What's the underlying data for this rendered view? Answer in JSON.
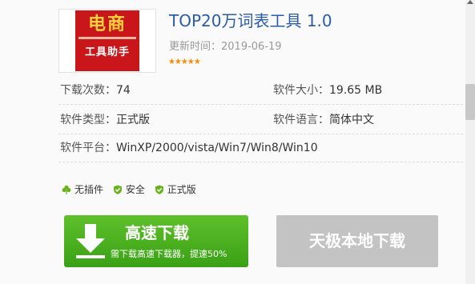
{
  "app": {
    "title": "TOP20万词表工具 1.0",
    "update_label": "更新时间：",
    "update_date": "2019-06-19",
    "rating_stars": "★★★★★"
  },
  "logo": {
    "line1": "电商",
    "line2": "工具助手",
    "brand_color": "#c9161b",
    "accent_color": "#ffd23c"
  },
  "info": {
    "downloads_label": "下载次数：",
    "downloads_value": "74",
    "size_label": "软件大小：",
    "size_value": "19.65 MB",
    "type_label": "软件类型：",
    "type_value": "正式版",
    "lang_label": "软件语言：",
    "lang_value": "简体中文",
    "platform_label": "软件平台：",
    "platform_value": "WinXP/2000/vista/Win7/Win8/Win10"
  },
  "tags": {
    "no_plugin": "无插件",
    "safe": "安全",
    "official": "正式版",
    "icons": [
      "clover-icon",
      "shield-check-icon",
      "shield-check-icon"
    ],
    "icon_color": "#6bb31e"
  },
  "buttons": {
    "fast_download_label": "高速下载",
    "fast_download_sub": "需下载高速下载器，提速50%",
    "fast_color": "#4cb020",
    "local_download_label": "天极本地下载",
    "local_color": "#c3c3c3"
  }
}
